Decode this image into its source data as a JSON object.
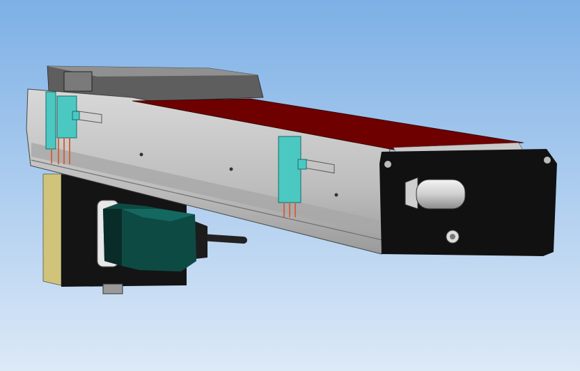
{
  "viewport": {
    "background_top": "#7db0e6",
    "background_bottom": "#dce9f7"
  },
  "model": {
    "belt_color": "#6e0000",
    "body_color": "#c4c4c4",
    "end_plate_color": "#111111",
    "motor_color": "#0e4a44",
    "sensor_color": "#4cc8c2",
    "side_plate_color": "#cfc47a"
  }
}
